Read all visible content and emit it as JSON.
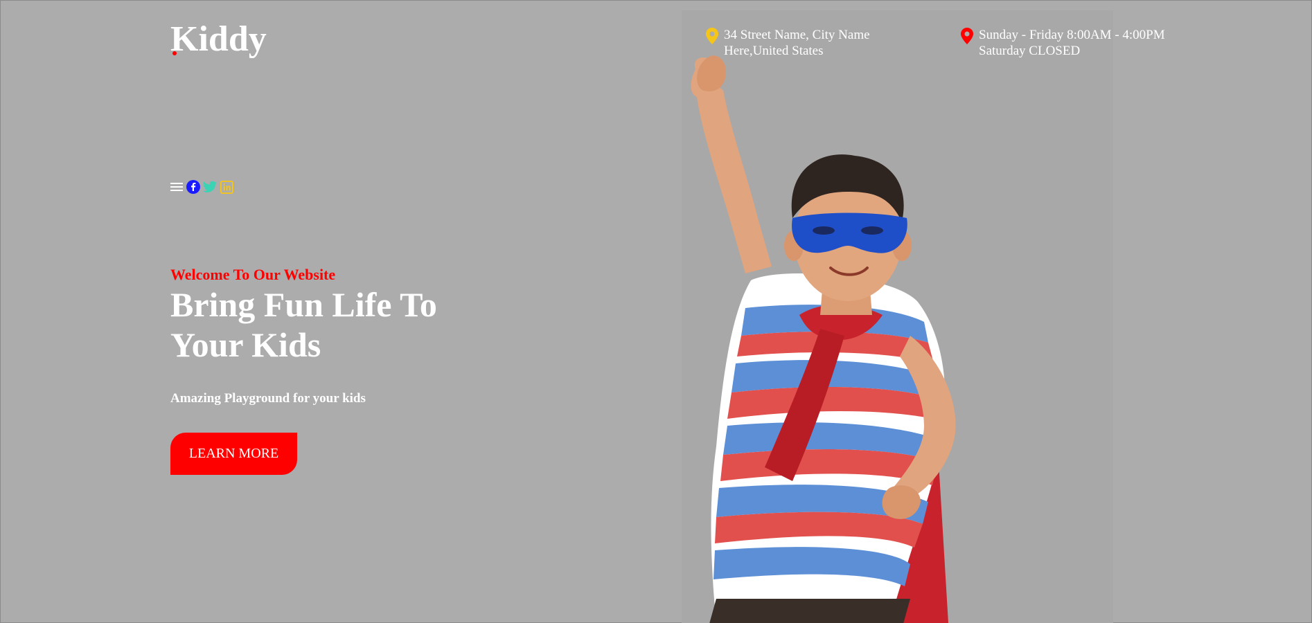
{
  "brand": {
    "name": "Kiddy"
  },
  "header": {
    "address_line1": "34 Street Name, City Name",
    "address_line2": "Here,United States",
    "hours_line1": "Sunday - Friday 8:00AM - 4:00PM",
    "hours_line2": "Saturday CLOSED"
  },
  "social": [
    {
      "icon": "menu-icon"
    },
    {
      "icon": "facebook-icon"
    },
    {
      "icon": "twitter-icon"
    },
    {
      "icon": "linkedin-icon"
    }
  ],
  "hero": {
    "eyebrow": "Welcome To Our Website",
    "headline": "Bring Fun Life To Your Kids",
    "subtext": "Amazing Playground for your kids",
    "cta_label": "LEARN MORE"
  },
  "colors": {
    "background": "#acacac",
    "accent": "#ff0000",
    "address_pin": "#f5c518",
    "hours_pin": "#ff0000",
    "facebook": "#1a1aff",
    "twitter": "#3ad3b4",
    "linkedin": "#f5c518"
  }
}
